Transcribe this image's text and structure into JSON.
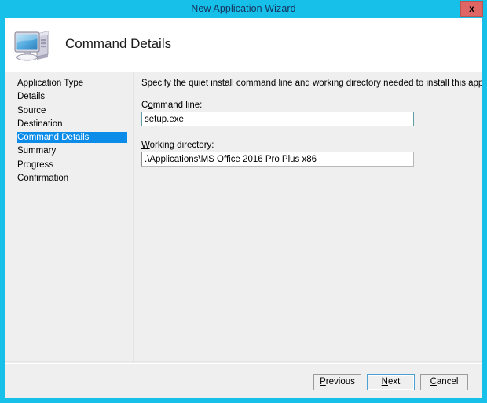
{
  "window": {
    "title": "New Application Wizard",
    "close_label": "x",
    "titlebar_color": "#16c0e8",
    "close_button_color": "#e06666"
  },
  "header": {
    "page_title": "Command Details",
    "icon": "computer-icon"
  },
  "sidebar": {
    "items": [
      {
        "label": "Application Type",
        "active": false
      },
      {
        "label": "Details",
        "active": false
      },
      {
        "label": "Source",
        "active": false
      },
      {
        "label": "Destination",
        "active": false
      },
      {
        "label": "Command Details",
        "active": true
      },
      {
        "label": "Summary",
        "active": false
      },
      {
        "label": "Progress",
        "active": false
      },
      {
        "label": "Confirmation",
        "active": false
      }
    ],
    "highlight_color": "#0c8ce9"
  },
  "content": {
    "intro_text": "Specify the quiet install command line and working directory needed to install this application.",
    "fields": [
      {
        "label_prefix": "C",
        "label_accel": "o",
        "label_suffix": "mmand line:",
        "value": "setup.exe",
        "placeholder": "",
        "focused": true
      },
      {
        "label_prefix": "",
        "label_accel": "W",
        "label_suffix": "orking directory:",
        "value": ".\\Applications\\MS Office 2016 Pro Plus x86",
        "placeholder": "",
        "focused": false
      }
    ]
  },
  "footer": {
    "buttons": [
      {
        "prefix": "",
        "accel": "P",
        "suffix": "revious",
        "default": false
      },
      {
        "prefix": "",
        "accel": "N",
        "suffix": "ext",
        "default": true
      },
      {
        "prefix": "",
        "accel": "C",
        "suffix": "ancel",
        "default": false
      }
    ]
  }
}
